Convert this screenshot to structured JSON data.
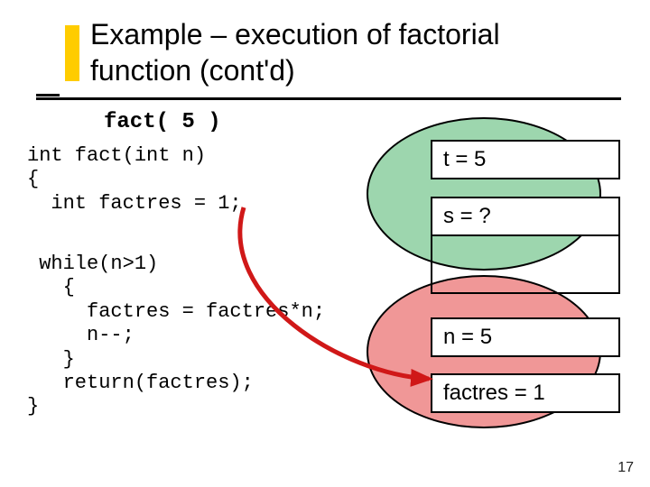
{
  "title_line1": "Example – execution of factorial",
  "title_line2": "function (cont'd)",
  "call_label": "fact( 5 )",
  "code_block1": "int fact(int n)\n{\n  int factres = 1;",
  "code_block2": " while(n>1)\n   {\n     factres = factres*n;\n     n--;\n   }\n   return(factres);\n}",
  "vars": {
    "t": "t = 5",
    "s": "s = ?",
    "n": "n = 5",
    "factres": "factres = 1"
  },
  "page_number": "17",
  "colors": {
    "accent": "#ffcc00",
    "green": "#5bba78",
    "red": "#e86060",
    "arrow": "#d01818"
  }
}
